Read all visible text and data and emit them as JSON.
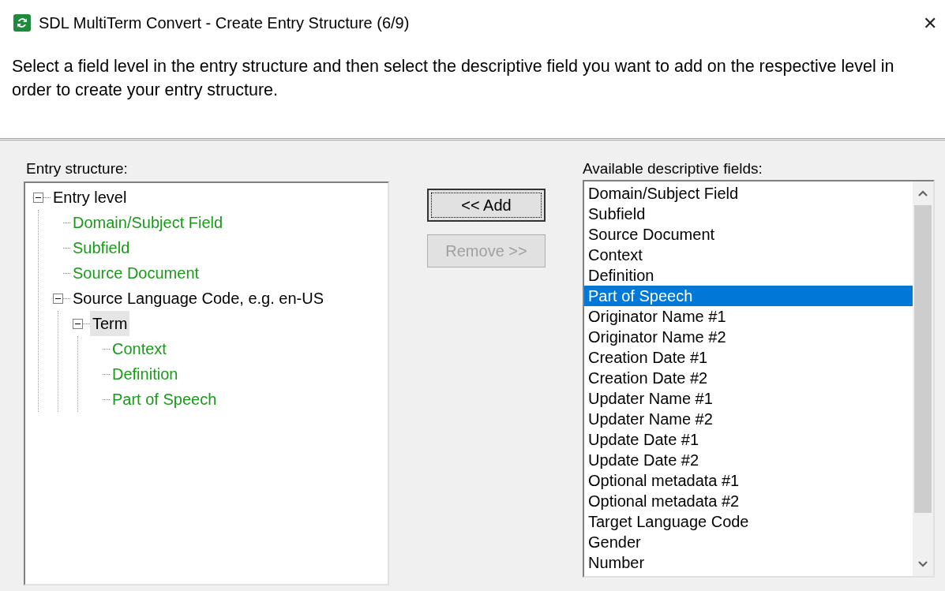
{
  "window": {
    "title": "SDL MultiTerm Convert - Create Entry Structure (6/9)",
    "close": "✕"
  },
  "instructions": "Select a field level in the entry structure and then select the descriptive field you want to add on the respective level in order to create your entry structure.",
  "entry_structure": {
    "label": "Entry structure:",
    "tree": [
      {
        "label": "Entry level",
        "kind": "level",
        "expanded": true,
        "selected": false,
        "children": [
          {
            "label": "Domain/Subject Field",
            "kind": "field",
            "selected": false
          },
          {
            "label": "Subfield",
            "kind": "field",
            "selected": false
          },
          {
            "label": "Source Document",
            "kind": "field",
            "selected": false
          },
          {
            "label": "Source Language Code, e.g. en-US",
            "kind": "level",
            "expanded": true,
            "selected": false,
            "children": [
              {
                "label": "Term",
                "kind": "level",
                "expanded": true,
                "selected": true,
                "children": [
                  {
                    "label": "Context",
                    "kind": "field",
                    "selected": false
                  },
                  {
                    "label": "Definition",
                    "kind": "field",
                    "selected": false
                  },
                  {
                    "label": "Part of Speech",
                    "kind": "field",
                    "selected": false
                  }
                ]
              }
            ]
          }
        ]
      }
    ]
  },
  "buttons": [
    {
      "label": "<< Add",
      "disabled": false
    },
    {
      "label": "Remove >>",
      "disabled": true
    }
  ],
  "available_fields": {
    "label": "Available descriptive fields:",
    "items": [
      {
        "label": "Domain/Subject Field",
        "selected": false
      },
      {
        "label": "Subfield",
        "selected": false
      },
      {
        "label": "Source Document",
        "selected": false
      },
      {
        "label": "Context",
        "selected": false
      },
      {
        "label": "Definition",
        "selected": false
      },
      {
        "label": "Part of Speech",
        "selected": true
      },
      {
        "label": "Originator Name #1",
        "selected": false
      },
      {
        "label": "Originator Name #2",
        "selected": false
      },
      {
        "label": "Creation Date #1",
        "selected": false
      },
      {
        "label": "Creation Date #2",
        "selected": false
      },
      {
        "label": "Updater Name #1",
        "selected": false
      },
      {
        "label": "Updater Name #2",
        "selected": false
      },
      {
        "label": "Update Date #1",
        "selected": false
      },
      {
        "label": "Update Date #2",
        "selected": false
      },
      {
        "label": "Optional metadata #1",
        "selected": false
      },
      {
        "label": "Optional metadata #2",
        "selected": false
      },
      {
        "label": "Target Language Code",
        "selected": false
      },
      {
        "label": "Gender",
        "selected": false
      },
      {
        "label": "Number",
        "selected": false
      }
    ]
  }
}
